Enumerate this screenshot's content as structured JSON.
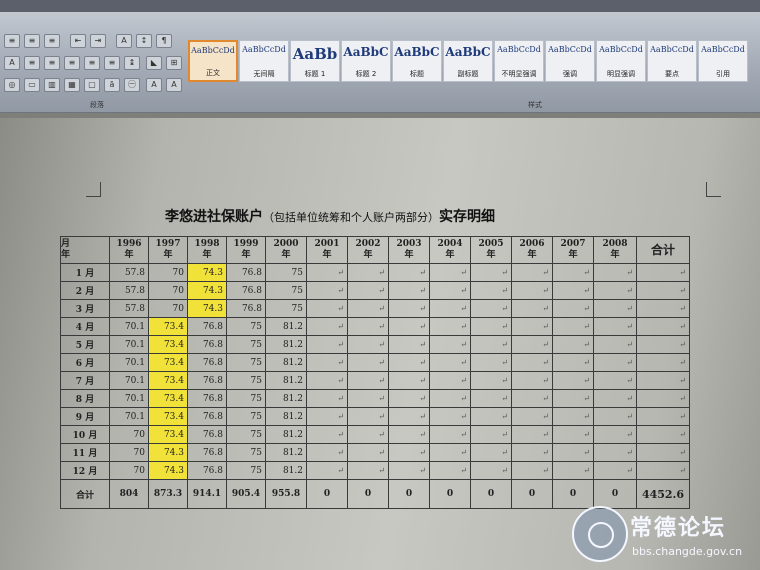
{
  "window": {
    "title": ""
  },
  "menu_tabs": [
    "",
    "",
    ""
  ],
  "ribbon": {
    "styles": [
      {
        "sample": "AaBbCcDd",
        "name": "正文",
        "selected": true,
        "size": 8
      },
      {
        "sample": "AaBbCcDd",
        "name": "无间隔",
        "selected": false,
        "size": 8
      },
      {
        "sample": "AaBb",
        "name": "标题 1",
        "selected": false,
        "size": 15
      },
      {
        "sample": "AaBbC",
        "name": "标题 2",
        "selected": false,
        "size": 12
      },
      {
        "sample": "AaBbC",
        "name": "标题",
        "selected": false,
        "size": 12
      },
      {
        "sample": "AaBbC",
        "name": "副标题",
        "selected": false,
        "size": 12
      },
      {
        "sample": "AaBbCcDd",
        "name": "不明显强调",
        "selected": false,
        "size": 8
      },
      {
        "sample": "AaBbCcDd",
        "name": "强调",
        "selected": false,
        "size": 8
      },
      {
        "sample": "AaBbCcDd",
        "name": "明显强调",
        "selected": false,
        "size": 8
      },
      {
        "sample": "AaBbCcDd",
        "name": "要点",
        "selected": false,
        "size": 8
      },
      {
        "sample": "AaBbCcDd",
        "name": "引用",
        "selected": false,
        "size": 8
      }
    ],
    "groups": {
      "font": "段落",
      "styles": "样式"
    }
  },
  "document": {
    "heading_name": "李悠进社保账户",
    "heading_sub": "（包括单位统筹和个人账户两部分）",
    "heading_tail": "实存明细"
  },
  "table": {
    "corner_top": "月",
    "corner_bottom": "年",
    "year_suffix": "年",
    "years": [
      "1996",
      "1997",
      "1998",
      "1999",
      "2000",
      "2001",
      "2002",
      "2003",
      "2004",
      "2005",
      "2006",
      "2007",
      "2008"
    ],
    "total_header": "合计",
    "rows": [
      {
        "label": "1 月",
        "cells": [
          "57.8",
          "70",
          "74.3",
          "76.8",
          "75"
        ]
      },
      {
        "label": "2 月",
        "cells": [
          "57.8",
          "70",
          "74.3",
          "76.8",
          "75"
        ]
      },
      {
        "label": "3 月",
        "cells": [
          "57.8",
          "70",
          "74.3",
          "76.8",
          "75"
        ]
      },
      {
        "label": "4 月",
        "cells": [
          "70.1",
          "73.4",
          "76.8",
          "75",
          "81.2"
        ]
      },
      {
        "label": "5 月",
        "cells": [
          "70.1",
          "73.4",
          "76.8",
          "75",
          "81.2"
        ]
      },
      {
        "label": "6 月",
        "cells": [
          "70.1",
          "73.4",
          "76.8",
          "75",
          "81.2"
        ]
      },
      {
        "label": "7 月",
        "cells": [
          "70.1",
          "73.4",
          "76.8",
          "75",
          "81.2"
        ]
      },
      {
        "label": "8 月",
        "cells": [
          "70.1",
          "73.4",
          "76.8",
          "75",
          "81.2"
        ]
      },
      {
        "label": "9 月",
        "cells": [
          "70.1",
          "73.4",
          "76.8",
          "75",
          "81.2"
        ]
      },
      {
        "label": "10 月",
        "cells": [
          "70",
          "73.4",
          "76.8",
          "75",
          "81.2"
        ]
      },
      {
        "label": "11 月",
        "cells": [
          "70",
          "74.3",
          "76.8",
          "75",
          "81.2"
        ]
      },
      {
        "label": "12 月",
        "cells": [
          "70",
          "74.3",
          "76.8",
          "75",
          "81.2"
        ]
      }
    ],
    "highlight_color": "#f1e23a",
    "highlight": {
      "rows_1_3_col": 2,
      "rows_4_12_col": 1
    },
    "total_row": {
      "label": "合计",
      "cells": [
        "804",
        "873.3",
        "914.1",
        "905.4",
        "955.8",
        "0",
        "0",
        "0",
        "0",
        "0",
        "0",
        "0",
        "0"
      ],
      "grand_total": "4452.6"
    },
    "cell_mark": "↵"
  },
  "watermark": {
    "name": "常德论坛",
    "url": "bbs.changde.gov.cn"
  }
}
